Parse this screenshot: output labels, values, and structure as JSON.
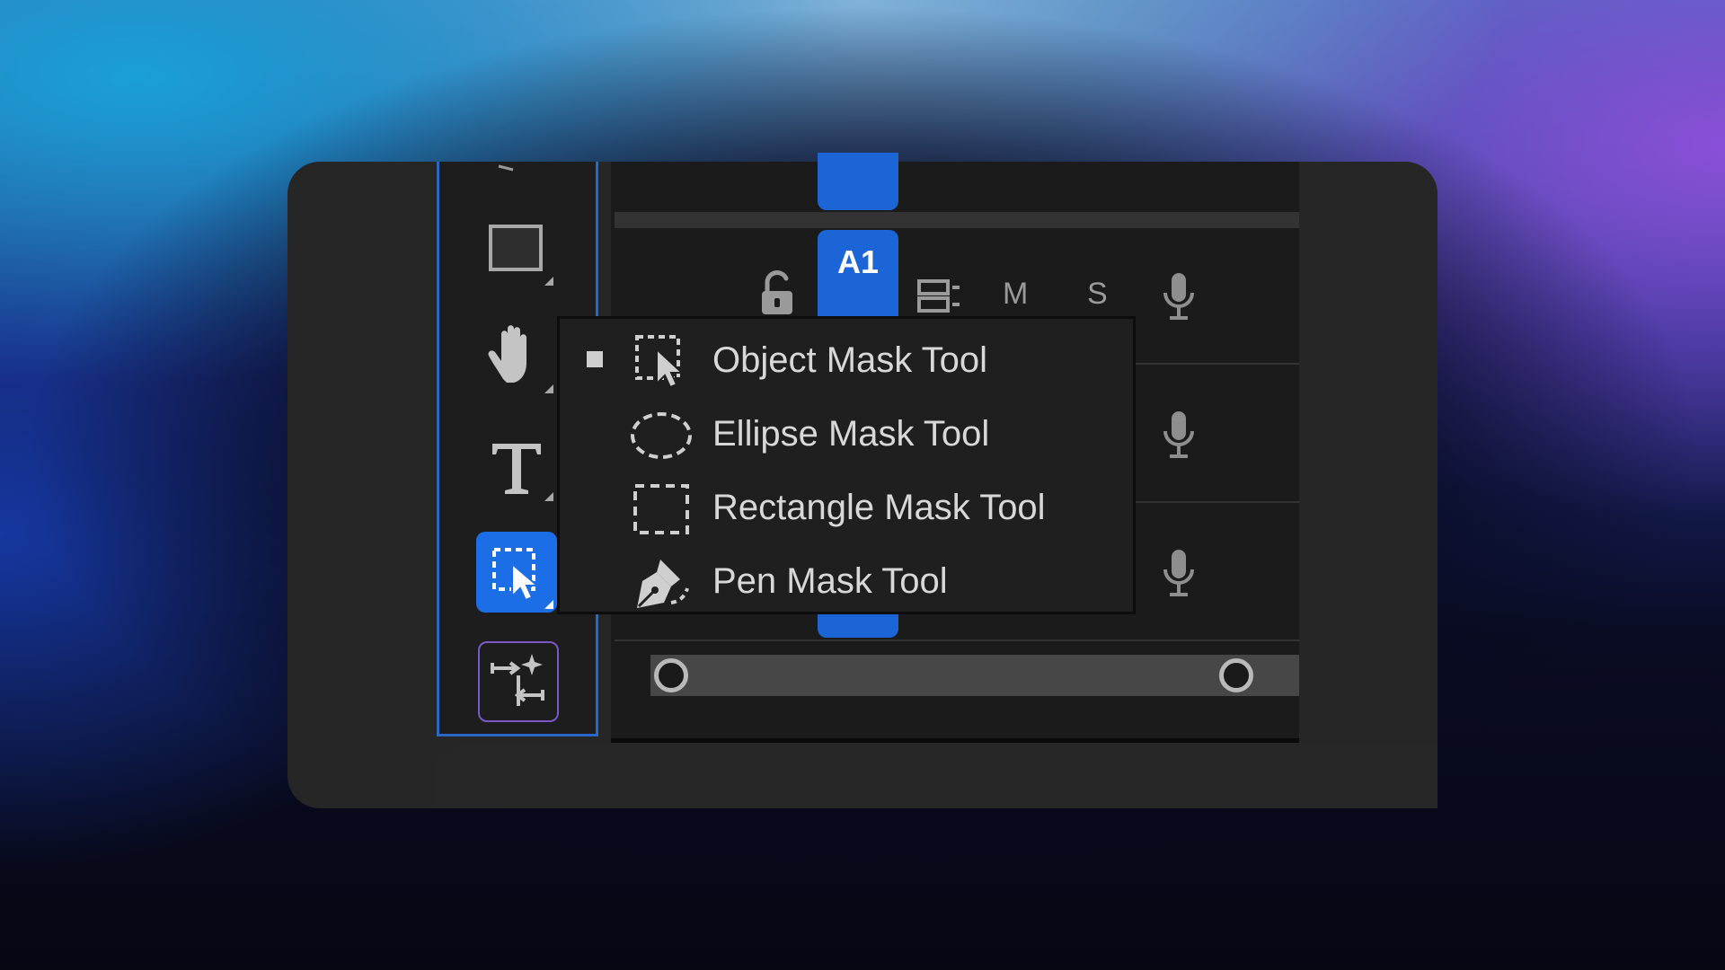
{
  "colors": {
    "accent_blue": "#1c65d6",
    "selected_tool": "#1c6ee6",
    "panel_bg": "#262626",
    "menu_bg": "#1f1f1f",
    "remix_border": "#7a58c8"
  },
  "toolbar": {
    "tools": [
      {
        "name": "rectangle-tool",
        "icon": "rectangle-icon",
        "selected": false
      },
      {
        "name": "hand-tool",
        "icon": "hand-icon",
        "selected": false
      },
      {
        "name": "type-tool",
        "icon": "type-icon",
        "selected": false
      },
      {
        "name": "object-mask-tool",
        "icon": "object-mask-icon",
        "selected": true
      },
      {
        "name": "remix-tool",
        "icon": "remix-icon",
        "selected": false
      }
    ]
  },
  "timeline": {
    "track": {
      "label": "A1",
      "mute_label": "M",
      "solo_label": "S",
      "icons": [
        "lock-open-icon",
        "sync-lock-icon",
        "microphone-icon"
      ]
    },
    "extra_mic_icons": [
      "microphone-icon",
      "microphone-icon"
    ],
    "zoom_scrollbar": {
      "start_fraction": 0.0,
      "end_fraction": 1.0
    }
  },
  "menu": {
    "items": [
      {
        "label": "Object Mask Tool",
        "icon": "object-mask-icon",
        "checked": true
      },
      {
        "label": "Ellipse Mask Tool",
        "icon": "ellipse-mask-icon",
        "checked": false
      },
      {
        "label": "Rectangle Mask Tool",
        "icon": "rectangle-mask-icon",
        "checked": false
      },
      {
        "label": "Pen Mask Tool",
        "icon": "pen-mask-icon",
        "checked": false
      }
    ]
  }
}
